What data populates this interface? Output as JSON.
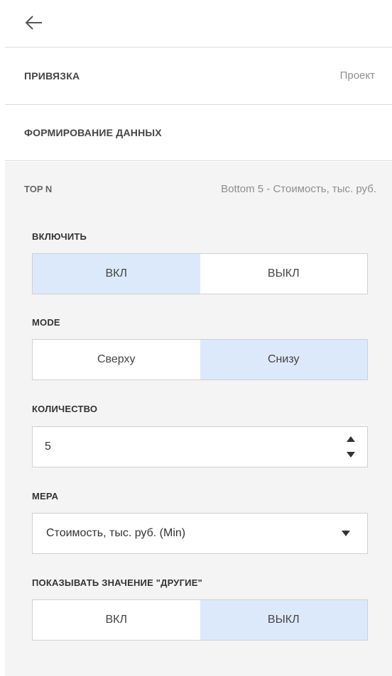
{
  "header": {
    "back_icon": "arrow-left-icon"
  },
  "binding": {
    "title": "ПРИВЯЗКА",
    "value": "Проект"
  },
  "data_formation": {
    "title": "ФОРМИРОВАНИЕ ДАННЫХ"
  },
  "topn": {
    "label": "TOP N",
    "value": "Bottom 5 - Стоимость, тыс. руб."
  },
  "enable": {
    "label": "ВКЛЮЧИТЬ",
    "options": [
      "ВКЛ",
      "ВЫКЛ"
    ],
    "selected": "ВКЛ"
  },
  "mode": {
    "label": "MODE",
    "options": [
      "Сверху",
      "Снизу"
    ],
    "selected": "Снизу"
  },
  "quantity": {
    "label": "КОЛИЧЕСТВО",
    "value": "5",
    "icons": {
      "up": "caret-up-icon",
      "down": "caret-down-icon"
    }
  },
  "measure": {
    "label": "МЕРА",
    "value": "Стоимость, тыс. руб. (Min)",
    "icon": "caret-down-icon"
  },
  "show_others": {
    "label": "ПОКАЗЫВАТЬ ЗНАЧЕНИЕ \"ДРУГИЕ\"",
    "options": [
      "ВКЛ",
      "ВЫКЛ"
    ],
    "selected": "ВЫКЛ"
  },
  "colors": {
    "selected_bg": "#dce9fb",
    "panel_bg": "#f4f4f4",
    "border": "#d0d0d0"
  }
}
